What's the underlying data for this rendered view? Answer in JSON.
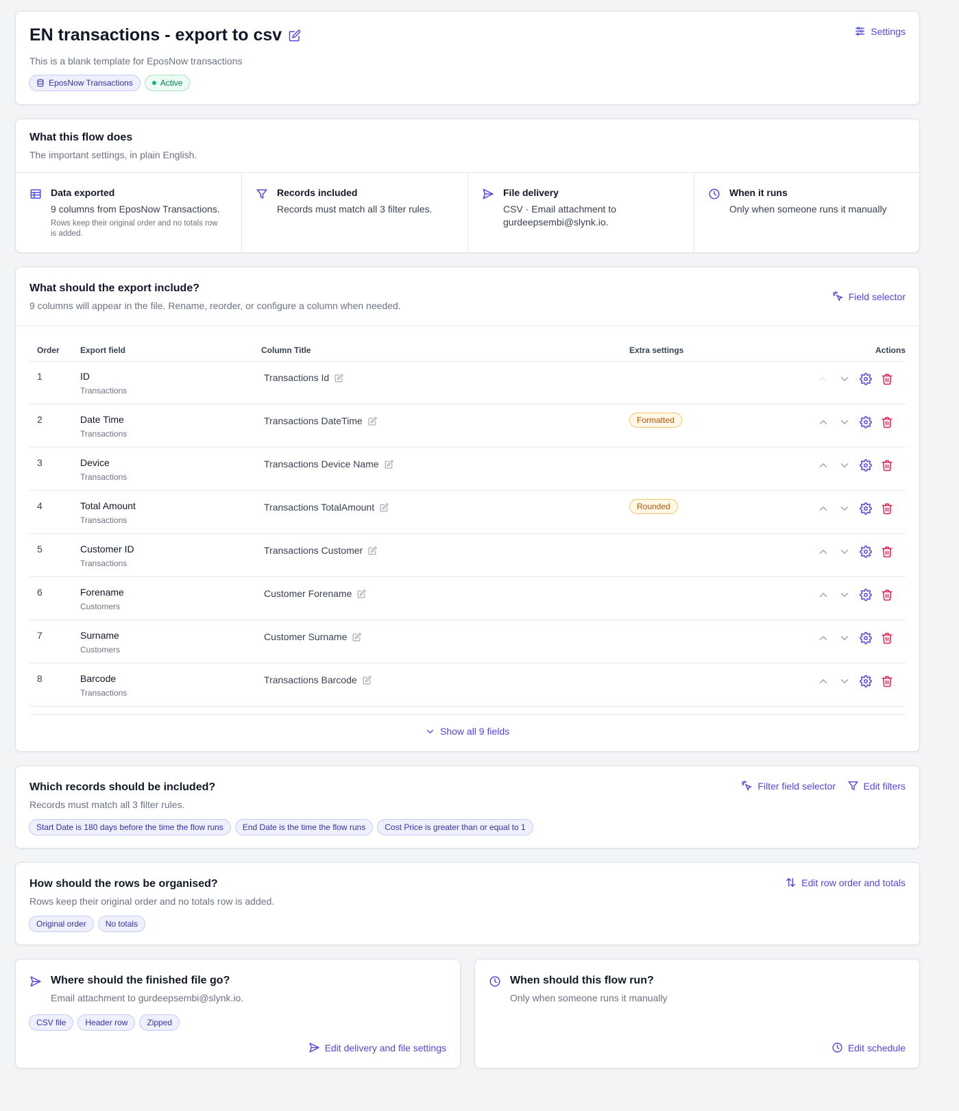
{
  "header": {
    "title": "EN transactions - export to csv",
    "description": "This is a blank template for EposNow transactions",
    "source_badge": "EposNow Transactions",
    "status_badge": "Active",
    "settings_label": "Settings"
  },
  "summary": {
    "title": "What this flow does",
    "subtitle": "The important settings, in plain English.",
    "items": [
      {
        "icon": "table-icon",
        "title": "Data exported",
        "desc": "9 columns from EposNow Transactions.",
        "small": "Rows keep their original order and no totals row is added."
      },
      {
        "icon": "filter-icon",
        "title": "Records included",
        "desc": "Records must match all 3 filter rules.",
        "small": ""
      },
      {
        "icon": "send-icon",
        "title": "File delivery",
        "desc": "CSV · Email attachment to gurdeepsembi@slynk.io.",
        "small": ""
      },
      {
        "icon": "clock-icon",
        "title": "When it runs",
        "desc": "Only when someone runs it manually",
        "small": ""
      }
    ]
  },
  "export": {
    "title": "What should the export include?",
    "subtitle": "9 columns will appear in the file. Rename, reorder, or configure a column when needed.",
    "field_selector_label": "Field selector",
    "columns": {
      "order": "Order",
      "field": "Export field",
      "title": "Column Title",
      "extra": "Extra settings",
      "actions": "Actions"
    },
    "rows": [
      {
        "order": "1",
        "field": "ID",
        "source": "Transactions",
        "title": "Transactions Id",
        "extra": ""
      },
      {
        "order": "2",
        "field": "Date Time",
        "source": "Transactions",
        "title": "Transactions DateTime",
        "extra": "Formatted"
      },
      {
        "order": "3",
        "field": "Device",
        "source": "Transactions",
        "title": "Transactions Device Name",
        "extra": ""
      },
      {
        "order": "4",
        "field": "Total Amount",
        "source": "Transactions",
        "title": "Transactions TotalAmount",
        "extra": "Rounded"
      },
      {
        "order": "5",
        "field": "Customer ID",
        "source": "Transactions",
        "title": "Transactions Customer",
        "extra": ""
      },
      {
        "order": "6",
        "field": "Forename",
        "source": "Customers",
        "title": "Customer Forename",
        "extra": ""
      },
      {
        "order": "7",
        "field": "Surname",
        "source": "Customers",
        "title": "Customer Surname",
        "extra": ""
      },
      {
        "order": "8",
        "field": "Barcode",
        "source": "Transactions",
        "title": "Transactions Barcode",
        "extra": ""
      }
    ],
    "show_all_label": "Show all 9 fields"
  },
  "filters": {
    "title": "Which records should be included?",
    "subtitle": "Records must match all 3 filter rules.",
    "filter_field_selector_label": "Filter field selector",
    "edit_filters_label": "Edit filters",
    "rules": [
      "Start Date is 180 days before the time the flow runs",
      "End Date is the time the flow runs",
      "Cost Price is greater than or equal to 1"
    ]
  },
  "rows_org": {
    "title": "How should the rows be organised?",
    "subtitle": "Rows keep their original order and no totals row is added.",
    "edit_label": "Edit row order and totals",
    "tags": [
      "Original order",
      "No totals"
    ]
  },
  "delivery": {
    "title": "Where should the finished file go?",
    "subtitle": "Email attachment to gurdeepsembi@slynk.io.",
    "tags": [
      "CSV file",
      "Header row",
      "Zipped"
    ],
    "edit_label": "Edit delivery and file settings"
  },
  "schedule": {
    "title": "When should this flow run?",
    "subtitle": "Only when someone runs it manually",
    "edit_label": "Edit schedule"
  },
  "colors": {
    "accent": "#4f46e5",
    "danger": "#e11d48",
    "success": "#10b981",
    "warning": "#b45309"
  }
}
